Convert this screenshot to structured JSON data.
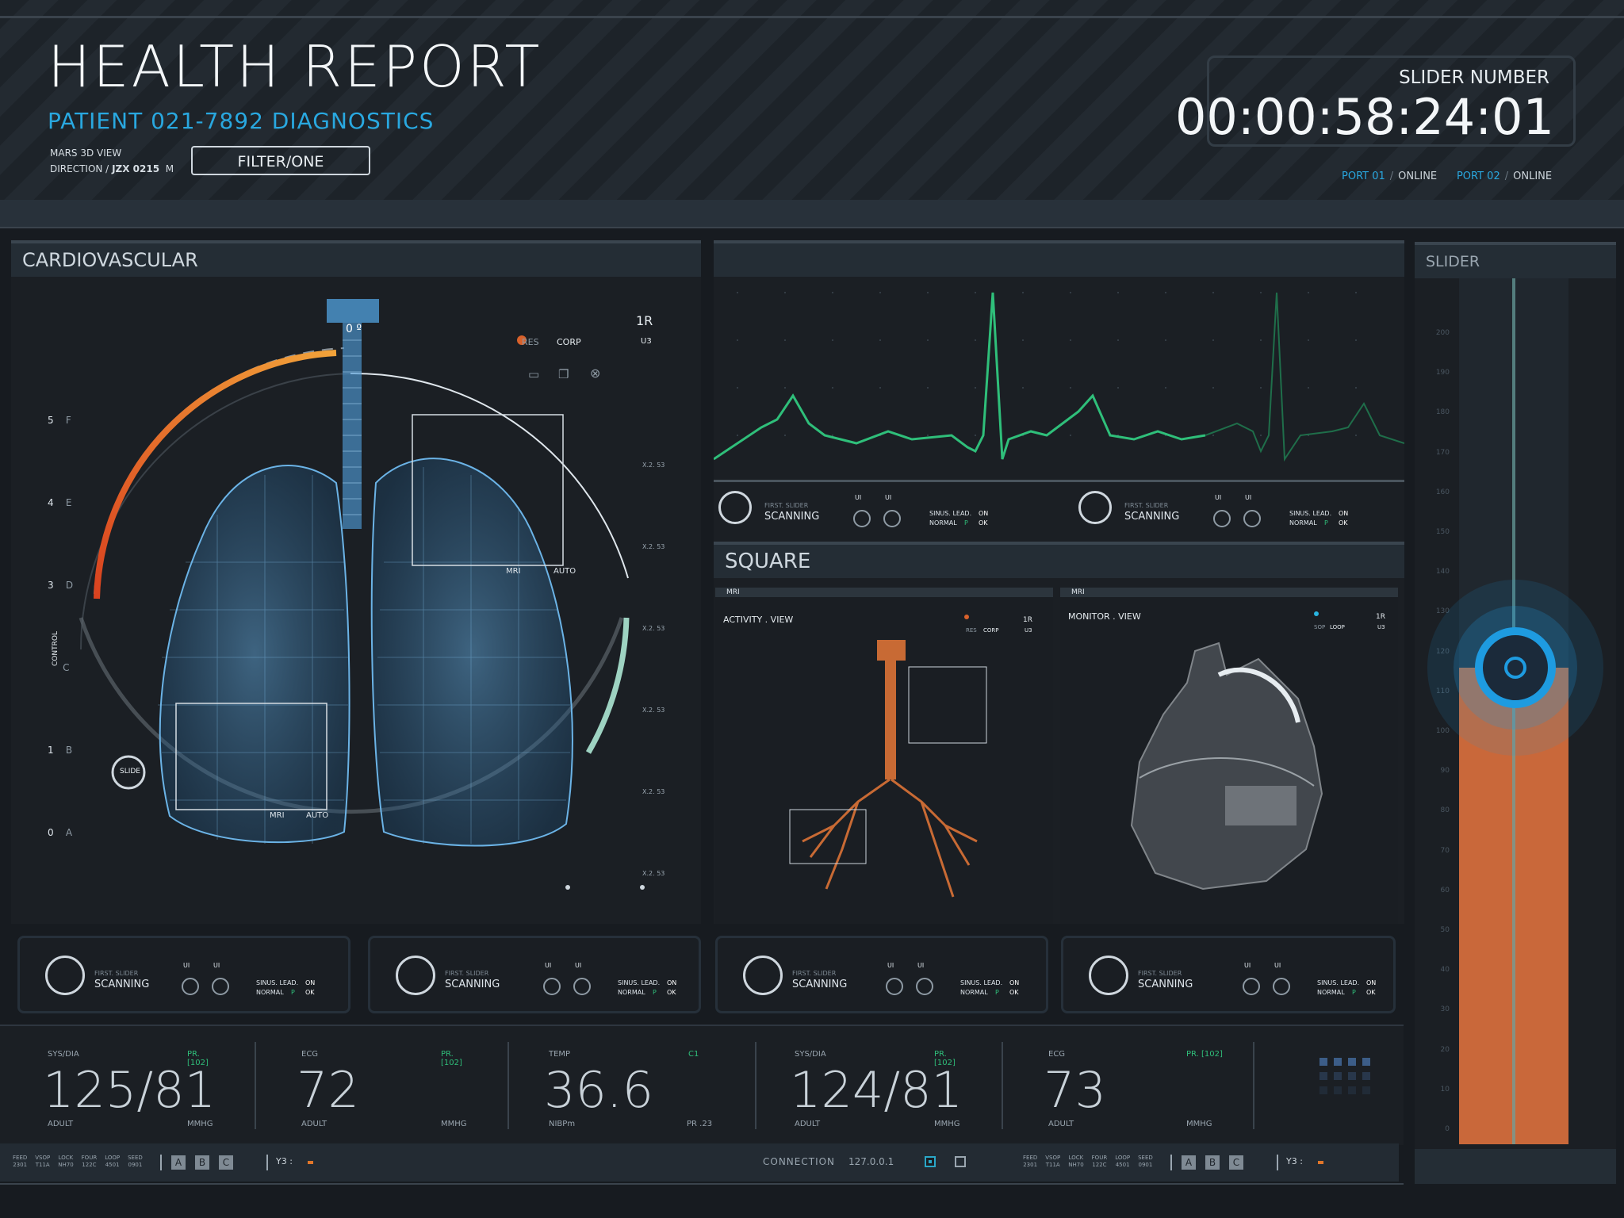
{
  "header": {
    "title": "HEALTH REPORT",
    "subtitle": "PATIENT 021-7892 DIAGNOSTICS",
    "meta_line1": "MARS 3D VIEW",
    "meta_line2_prefix": "DIRECTION /",
    "meta_line2_code": "JZX 0215",
    "meta_line2_suffix": "M",
    "filter_button": "FILTER/ONE",
    "timer_label": "SLIDER NUMBER",
    "timer_value": "00:00:58:24:01",
    "ports": [
      {
        "name": "PORT 01",
        "status": "ONLINE"
      },
      {
        "name": "PORT 02",
        "status": "ONLINE"
      }
    ]
  },
  "cardio": {
    "title": "CARDIOVASCULAR",
    "angle": "0 º",
    "res": "RES",
    "corp": "CORP",
    "rank": "1R",
    "u3": "U3",
    "mri": "MRI",
    "auto": "AUTO",
    "slide": "SLIDE",
    "control": "CONTROL",
    "scale_left": [
      {
        "num": "5",
        "letter": "F"
      },
      {
        "num": "4",
        "letter": "E"
      },
      {
        "num": "3",
        "letter": "D"
      },
      {
        "num": "",
        "letter": "C"
      },
      {
        "num": "1",
        "letter": "B"
      },
      {
        "num": "0",
        "letter": "A"
      }
    ],
    "scale_right": [
      "X.2. 53",
      "X.2. 53",
      "X.2. 53",
      "X.2. 53",
      "X.2. 53",
      "X.2. 53"
    ]
  },
  "ecg_controls": [
    {
      "first_slider": "FIRST. SLIDER",
      "scanning": "SCANNING",
      "ui1": "UI",
      "ui2": "UI",
      "sinus": "SINUS. LEAD.",
      "on": "ON",
      "normal": "NORMAL",
      "p": "P",
      "ok": "OK"
    },
    {
      "first_slider": "FIRST. SLIDER",
      "scanning": "SCANNING",
      "ui1": "UI",
      "ui2": "UI",
      "sinus": "SINUS. LEAD.",
      "on": "ON",
      "normal": "NORMAL",
      "p": "P",
      "ok": "OK"
    }
  ],
  "square": {
    "title": "SQUARE",
    "left": {
      "tag": "MRI",
      "view": "ACTIVITY . VIEW",
      "res": "RES",
      "corp": "CORP",
      "rank": "1R",
      "u3": "U3"
    },
    "right": {
      "tag": "MRI",
      "view": "MONITOR . VIEW",
      "sop": "SOP",
      "loop": "LOOP",
      "rank": "1R",
      "u3": "U3"
    }
  },
  "bottom_controls": [
    {
      "first_slider": "FIRST. SLIDER",
      "scanning": "SCANNING",
      "ui1": "UI",
      "ui2": "UI",
      "sinus": "SINUS. LEAD.",
      "on": "ON",
      "normal": "NORMAL",
      "p": "P",
      "ok": "OK"
    },
    {
      "first_slider": "FIRST. SLIDER",
      "scanning": "SCANNING",
      "ui1": "UI",
      "ui2": "UI",
      "sinus": "SINUS. LEAD.",
      "on": "ON",
      "normal": "NORMAL",
      "p": "P",
      "ok": "OK"
    },
    {
      "first_slider": "FIRST. SLIDER",
      "scanning": "SCANNING",
      "ui1": "UI",
      "ui2": "UI",
      "sinus": "SINUS. LEAD.",
      "on": "ON",
      "normal": "NORMAL",
      "p": "P",
      "ok": "OK"
    },
    {
      "first_slider": "FIRST. SLIDER",
      "scanning": "SCANNING",
      "ui1": "UI",
      "ui2": "UI",
      "sinus": "SINUS. LEAD.",
      "on": "ON",
      "normal": "NORMAL",
      "p": "P",
      "ok": "OK"
    }
  ],
  "vitals": [
    {
      "label": "SYS/DIA",
      "pr": "PR. [102]",
      "value": "125/81",
      "sub": "ADULT",
      "sub2": "MMHG"
    },
    {
      "label": "ECG",
      "pr": "PR. [102]",
      "value": "72",
      "sub": "ADULT",
      "sub2": "MMHG"
    },
    {
      "label": "TEMP",
      "pr": "C1",
      "value": "36.6",
      "sub": "NIBPm",
      "sub2": "PR .23"
    },
    {
      "label": "SYS/DIA",
      "pr": "PR. [102]",
      "value": "124/81",
      "sub": "ADULT",
      "sub2": "MMHG"
    },
    {
      "label": "ECG",
      "pr": "PR. [102]",
      "value": "73",
      "sub": "ADULT",
      "sub2": "MMHG"
    }
  ],
  "footer": {
    "codes": [
      {
        "top": "FEED",
        "bot": "2301"
      },
      {
        "top": "VSOP",
        "bot": "T11A"
      },
      {
        "top": "LOCK",
        "bot": "NH70"
      },
      {
        "top": "FOUR",
        "bot": "122C"
      },
      {
        "top": "LOOP",
        "bot": "4501"
      },
      {
        "top": "SEED",
        "bot": "0901"
      }
    ],
    "buttons": [
      "A",
      "B",
      "C"
    ],
    "y3": "Y3 :",
    "connection_label": "CONNECTION",
    "connection_ip": "127.0.0.1"
  },
  "slider": {
    "title": "SLIDER",
    "scale": [
      "200",
      "190",
      "180",
      "170",
      "160",
      "150",
      "140",
      "130",
      "120",
      "110",
      "100",
      "90",
      "80",
      "70",
      "60",
      "50",
      "40",
      "30",
      "20",
      "10",
      "0"
    ],
    "level": 0.55,
    "accent": "#c9683a",
    "ring": "#1e9be0"
  },
  "colors": {
    "accent_blue": "#29a8e0",
    "ecg_green": "#2fbf7a",
    "orange": "#e0762a",
    "background": "#171b20"
  }
}
